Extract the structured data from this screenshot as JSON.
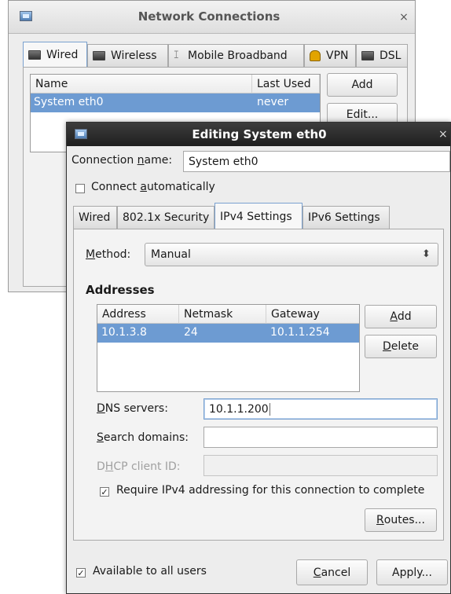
{
  "net_window": {
    "title": "Network Connections",
    "close_glyph": "×",
    "tabs": [
      {
        "label": "Wired",
        "icon": "wired-icon"
      },
      {
        "label": "Wireless",
        "icon": "wireless-icon"
      },
      {
        "label": "Mobile Broadband",
        "icon": "antenna-icon"
      },
      {
        "label": "VPN",
        "icon": "lock-icon"
      },
      {
        "label": "DSL",
        "icon": "dsl-icon"
      }
    ],
    "columns": [
      "Name",
      "Last Used"
    ],
    "rows": [
      {
        "name": "System eth0",
        "last_used": "never"
      }
    ],
    "add_label": "Add",
    "edit_label": "Edit..."
  },
  "edit_window": {
    "title": "Editing System eth0",
    "close_glyph": "×",
    "connection_name_label_pre": "Connection ",
    "connection_name_label_u": "n",
    "connection_name_label_post": "ame:",
    "connection_name_value": "System eth0",
    "connect_auto_pre": "Connect ",
    "connect_auto_u": "a",
    "connect_auto_post": "utomatically",
    "tabs": [
      "Wired",
      "802.1x Security",
      "IPv4 Settings",
      "IPv6 Settings"
    ],
    "method_label_u": "M",
    "method_label_post": "ethod:",
    "method_value": "Manual",
    "addresses_heading": "Addresses",
    "address_columns": [
      "Address",
      "Netmask",
      "Gateway"
    ],
    "address_rows": [
      {
        "address": "10.1.3.8",
        "netmask": "24",
        "gateway": "10.1.1.254"
      }
    ],
    "add_label_u": "A",
    "add_label_post": "dd",
    "delete_label_u": "D",
    "delete_label_post": "elete",
    "dns_label_u": "D",
    "dns_label_post": "NS servers:",
    "dns_value": "10.1.1.200",
    "search_label_u": "S",
    "search_label_post": "earch domains:",
    "search_value": "",
    "dhcp_label_pre": "D",
    "dhcp_label_u": "H",
    "dhcp_label_post": "CP client ID:",
    "dhcp_value": "",
    "require_ipv4_label": "Require IPv4 addressing for this connection to complete",
    "routes_label_u": "R",
    "routes_label_post": "outes...",
    "available_all_users_label": "Available to all users",
    "cancel_label_u": "C",
    "cancel_label_post": "ancel",
    "apply_label": "Apply...",
    "check_glyph": "✓",
    "spinner_glyph": "⬍"
  }
}
